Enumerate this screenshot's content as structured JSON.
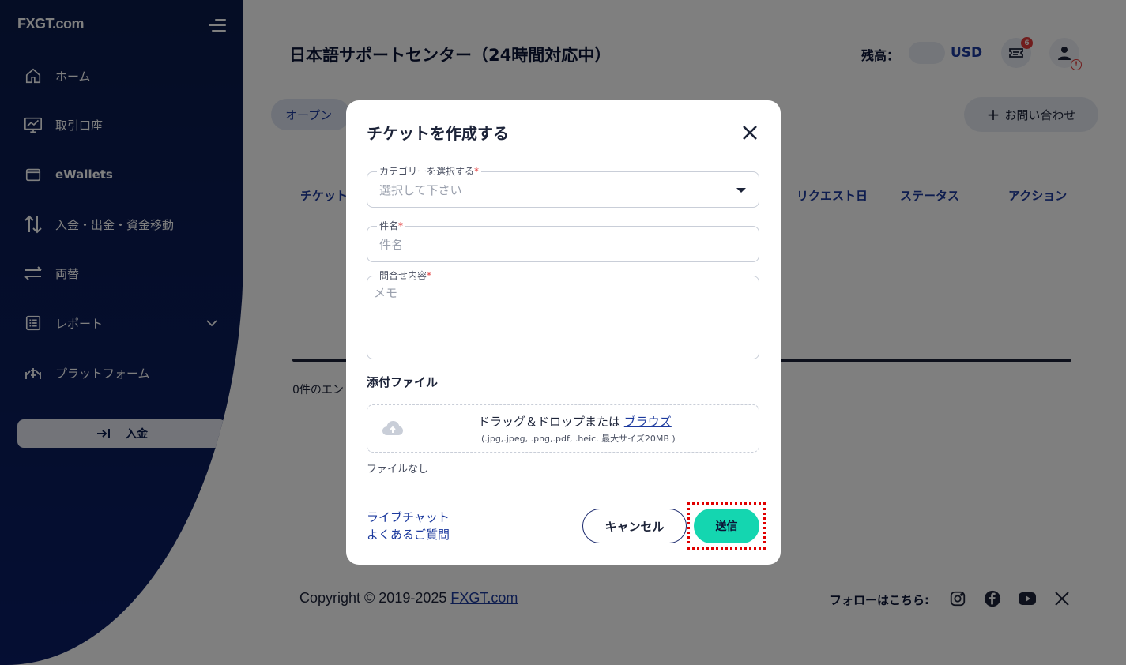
{
  "sidebar": {
    "logo": "FXGT.com",
    "items": [
      {
        "label": "ホーム",
        "icon": "home-icon"
      },
      {
        "label": "取引口座",
        "icon": "chart-monitor-icon"
      },
      {
        "label": "eWallets",
        "icon": "wallet-icon"
      },
      {
        "label": "入金・出金・資金移動",
        "icon": "transfer-arrows-icon"
      },
      {
        "label": "両替",
        "icon": "exchange-icon"
      },
      {
        "label": "レポート",
        "icon": "report-list-icon"
      },
      {
        "label": "プラットフォーム",
        "icon": "platform-icon"
      }
    ],
    "deposit_label": "入金"
  },
  "header": {
    "title": "日本語サポートセンター（24時間対応中）",
    "balance_label": "残高：",
    "currency": "USD",
    "ticket_badge": "6"
  },
  "tabs": {
    "open_label": "オープン"
  },
  "inquiry_button": "お問い合わせ",
  "table": {
    "headers": [
      "チケット",
      "リクエスト日",
      "ステータス",
      "アクション"
    ],
    "entries_text": "0件のエン"
  },
  "footer": {
    "copyright_prefix": "Copyright © 2019-2025 ",
    "copyright_link": "FXGT.com",
    "follow_label": "フォローはこちら:"
  },
  "modal": {
    "title": "チケットを作成する",
    "category": {
      "label": "カテゴリーを選択する",
      "placeholder": "選択して下さい"
    },
    "subject": {
      "label": "件名",
      "placeholder": "件名"
    },
    "content": {
      "label": "問合せ内容",
      "placeholder": "メモ"
    },
    "attach_title": "添付ファイル",
    "dropzone_text": "ドラッグ＆ドロップまたは ",
    "dropzone_link": "ブラウズ",
    "dropzone_hint": "(.jpg,.jpeg, .png,.pdf, .heic. 最大サイズ20MB )",
    "no_file": "ファイルなし",
    "live_chat": "ライブチャット",
    "faq": "よくあるご質問",
    "cancel_label": "キャンセル",
    "send_label": "送信"
  },
  "colors": {
    "sidebar_bg": "#0b1d66",
    "accent_blue": "#1c3a9e",
    "send_button": "#14d6b0",
    "highlight": "#e00000"
  }
}
